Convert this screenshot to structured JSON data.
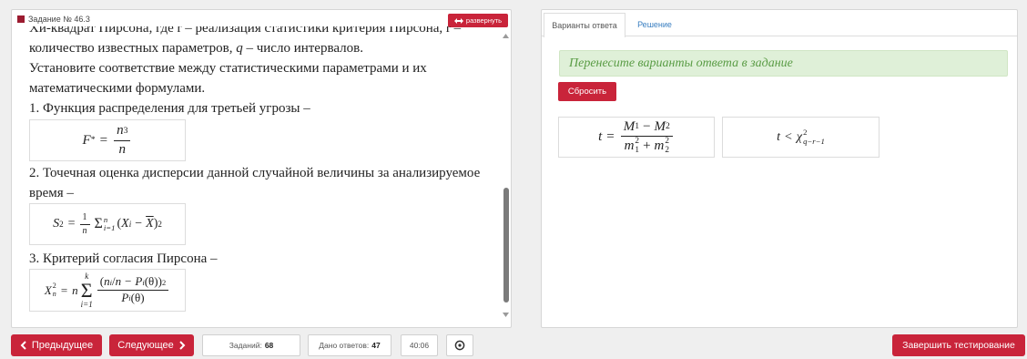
{
  "colors": {
    "accent": "#c9243a",
    "alert_bg": "#dff0d8",
    "alert_text": "#5a9c45",
    "link": "#3a7fc1",
    "task_marker": "#9b1b30"
  },
  "icons": {
    "task_marker": "square-icon",
    "expand": "expand-arrows-icon",
    "scroll_up": "arrow-up-icon",
    "scroll_down": "arrow-down-icon",
    "prev": "chevron-left-icon",
    "next": "chevron-right-icon",
    "settings": "settings-icon"
  },
  "task": {
    "title": "Задание № 46.3",
    "expand_label": "развернуть"
  },
  "question": {
    "clipped_line": "Хи-квадрат Пирсона, где r – реализация статистики критерия Пирсона, r –",
    "line_params": {
      "before": "количество известных параметров, ",
      "var": "q",
      "after": " – число интервалов."
    },
    "instruction": [
      "Установите соответствие между статистическими параметрами и их",
      "математическими формулами."
    ],
    "item_1": {
      "label": "1. Функция распределения для третьей угрозы –",
      "formula": {
        "lhs": "F",
        "lhs_sup": "*",
        "rel": "=",
        "num": "n",
        "num_sub": "3",
        "den": "n"
      }
    },
    "item_2": {
      "label": [
        "2. Точечная оценка дисперсии данной случайной величины за анализируемое",
        "время –"
      ],
      "formula": {
        "lhs": "S",
        "lhs_sup": "2",
        "rel": "=",
        "coef_num": "1",
        "coef_den": "n",
        "sum": "Σ",
        "sum_sup": "n",
        "sum_sub": "i=1",
        "lpar": "(",
        "x": "X",
        "x_sub": "i",
        "minus": "−",
        "mean": "X",
        "rpar": ")",
        "pow": "2"
      }
    },
    "item_3": {
      "label": "3. Критерий согласия Пирсона –",
      "formula": {
        "lhs": "X",
        "lhs_sup": "2",
        "lhs_sub": "n",
        "rel": "=",
        "coef": "n",
        "sum": "Σ",
        "sum_sup": "k",
        "sum_sub": "i=1",
        "num_lpar": "(",
        "num_n": "n",
        "num_n_sub": "i",
        "num_slash": "/",
        "num_n2": "n",
        "num_minus": "−",
        "num_p": "P",
        "num_p_sub": "i",
        "num_arg": "(θ)",
        "num_rpar": ")",
        "num_pow": "2",
        "den_p": "P",
        "den_p_sub": "i",
        "den_arg": "(θ)"
      }
    }
  },
  "answers": {
    "tabs": [
      {
        "label": "Варианты ответа",
        "active": true
      },
      {
        "label": "Решение",
        "active": false
      }
    ],
    "hint": "Перенесите варианты ответа в задание",
    "reset_label": "Сбросить",
    "options": [
      {
        "lhs": "t",
        "rel": "=",
        "num_m1": "M",
        "num_m1_sub": "1",
        "num_minus": "−",
        "num_m2": "M",
        "num_m2_sub": "2",
        "den_m1": "m",
        "den_m1_sup": "2",
        "den_m1_sub": "1",
        "den_plus": "+",
        "den_m2": "m",
        "den_m2_sup": "2",
        "den_m2_sub": "2"
      },
      {
        "lhs": "t",
        "rel": "<",
        "chi": "χ",
        "chi_sup": "2",
        "chi_sub": "q−r−1"
      }
    ]
  },
  "footer": {
    "prev_label": "Предыдущее",
    "next_label": "Следующее",
    "tasks_label": "Заданий:",
    "tasks_count": "68",
    "answered_label": "Дано ответов:",
    "answered_count": "47",
    "timer": "40:06",
    "finish_label": "Завершить тестирование"
  }
}
